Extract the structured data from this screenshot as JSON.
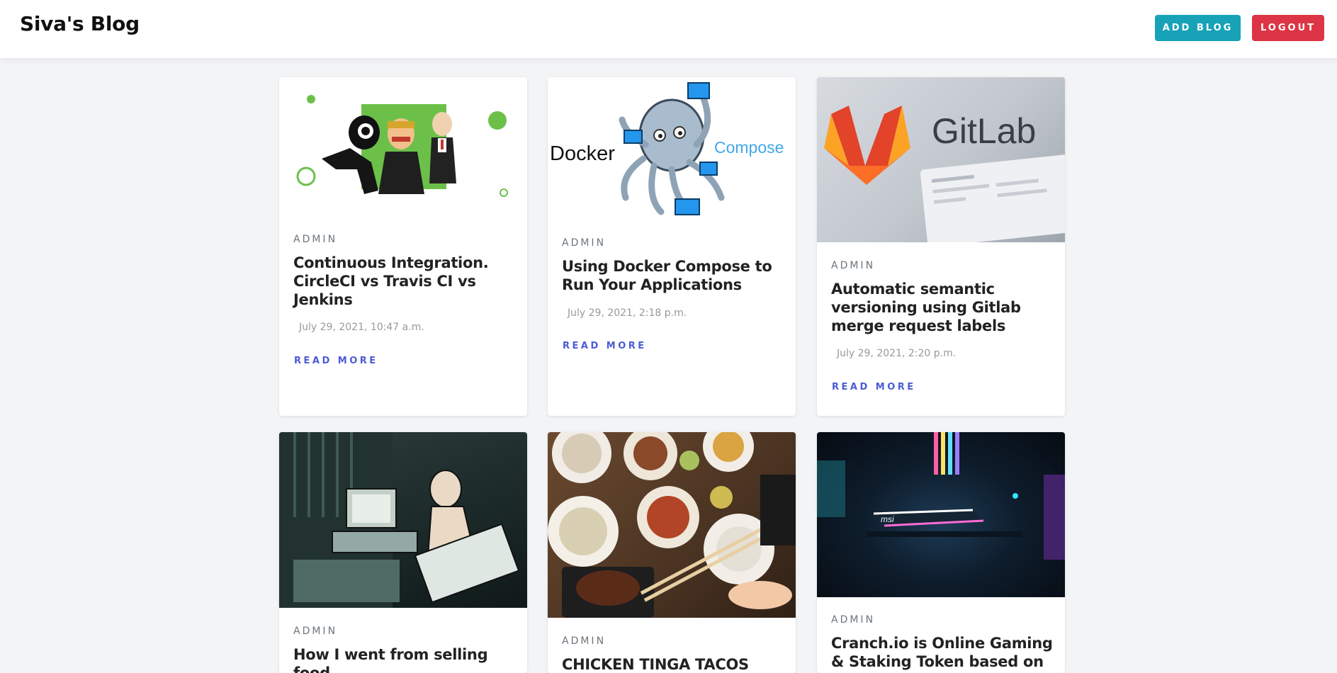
{
  "navbar": {
    "brand": "Siva's Blog",
    "add_blog_label": "ADD BLOG",
    "logout_label": "LOGOUT"
  },
  "posts": [
    {
      "author": "ADMIN",
      "title": "Continuous Integration. CircleCI vs Travis CI vs Jenkins",
      "date": "July 29, 2021, 10:47 a.m.",
      "read_more": "READ MORE"
    },
    {
      "author": "ADMIN",
      "title": "Using Docker Compose to Run Your Applications",
      "date": "July 29, 2021, 2:18 p.m.",
      "read_more": "READ MORE",
      "image_text": {
        "left": "Docker",
        "right": "Compose"
      }
    },
    {
      "author": "ADMIN",
      "title": "Automatic semantic versioning using Gitlab merge request labels",
      "date": "July 29, 2021, 2:20 p.m.",
      "read_more": "READ MORE",
      "image_text": {
        "brand": "GitLab"
      }
    },
    {
      "author": "ADMIN",
      "title": "How I went from selling food"
    },
    {
      "author": "ADMIN",
      "title": "CHICKEN TINGA TACOS"
    },
    {
      "author": "ADMIN",
      "title": "Cranch.io is Online Gaming & Staking Token based on the",
      "image_text": {
        "brand": "msi"
      }
    }
  ]
}
